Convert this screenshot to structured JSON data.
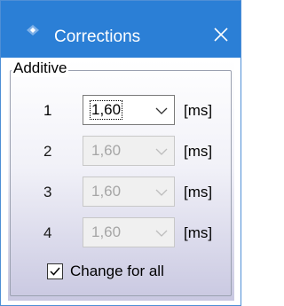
{
  "window": {
    "title": "Corrections",
    "icon": "app-icon",
    "close_icon": "close-icon",
    "titlebar_color": "#2b7fd6"
  },
  "group": {
    "label": "Additive"
  },
  "rows": [
    {
      "number": "1",
      "value": "1,60",
      "unit": "[ms]",
      "enabled": true,
      "focused": true
    },
    {
      "number": "2",
      "value": "1,60",
      "unit": "[ms]",
      "enabled": false,
      "focused": false
    },
    {
      "number": "3",
      "value": "1,60",
      "unit": "[ms]",
      "enabled": false,
      "focused": false
    },
    {
      "number": "4",
      "value": "1,60",
      "unit": "[ms]",
      "enabled": false,
      "focused": false
    }
  ],
  "change_for_all": {
    "label": "Change for all",
    "checked": true
  }
}
